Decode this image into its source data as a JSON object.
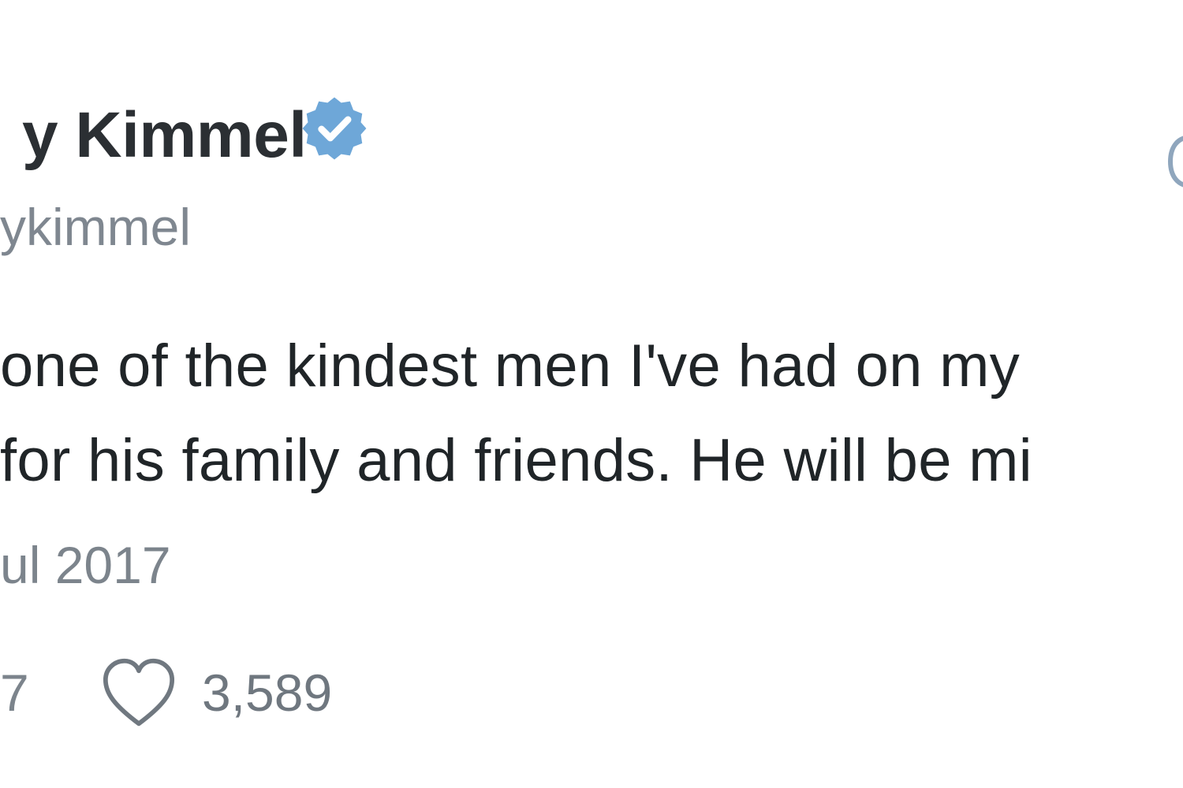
{
  "tweet": {
    "author": {
      "display_name": "y Kimmel",
      "handle": "ykimmel",
      "verified": true
    },
    "text_lines": [
      "one of the kindest men I've had on my",
      "for his family and friends. He will be mi"
    ],
    "timestamp": "ul 2017",
    "stats": {
      "retweets": "7",
      "likes": "3,589"
    }
  },
  "colors": {
    "verified_badge": "#6ea7d8",
    "text": "#202528",
    "secondary_text": "#7c848c",
    "background": "#ffffff"
  },
  "icons": {
    "verified": "verified-badge-icon",
    "like": "heart-icon"
  }
}
